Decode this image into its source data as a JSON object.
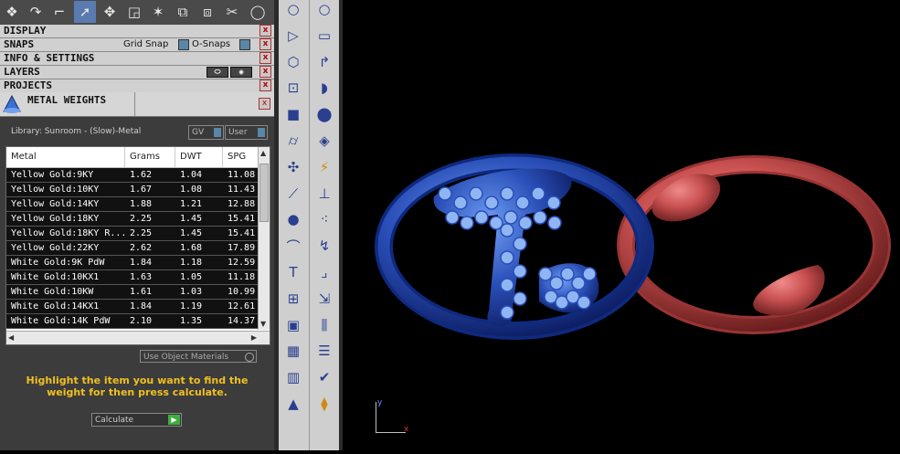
{
  "panels": {
    "display": "DISPLAY",
    "snaps": "SNAPS",
    "grid_snap": "Grid Snap",
    "o_snaps": "O-Snaps",
    "info": "INFO & SETTINGS",
    "layers": "LAYERS",
    "projects": "PROJECTS",
    "close": "x"
  },
  "metal_weights": {
    "title": "METAL WEIGHTS",
    "library": "Library: Sunroom - (Slow)-Metal",
    "gv_label": "GV",
    "user_label": "User",
    "columns": [
      "Metal",
      "Grams",
      "DWT",
      "SPG"
    ],
    "rows": [
      [
        "Yellow Gold:9KY",
        "1.62",
        "1.04",
        "11.08"
      ],
      [
        "Yellow Gold:10KY",
        "1.67",
        "1.08",
        "11.43"
      ],
      [
        "Yellow Gold:14KY",
        "1.88",
        "1.21",
        "12.88"
      ],
      [
        "Yellow Gold:18KY",
        "2.25",
        "1.45",
        "15.41"
      ],
      [
        "Yellow Gold:18KY R...",
        "2.25",
        "1.45",
        "15.41"
      ],
      [
        "Yellow Gold:22KY",
        "2.62",
        "1.68",
        "17.89"
      ],
      [
        "White Gold:9K PdW",
        "1.84",
        "1.18",
        "12.59"
      ],
      [
        "White Gold:10KX1",
        "1.63",
        "1.05",
        "11.18"
      ],
      [
        "White Gold:10KW",
        "1.61",
        "1.03",
        "10.99"
      ],
      [
        "White Gold:14KX1",
        "1.84",
        "1.19",
        "12.61"
      ],
      [
        "White Gold:14K PdW",
        "2.10",
        "1.35",
        "14.37"
      ]
    ],
    "use_object_materials": "Use Object Materials",
    "instruction": "Highlight the item you want to find the weight for then press calculate.",
    "calculate": "Calculate"
  },
  "viewport": {
    "axis_y": "y",
    "axis_x": "x",
    "colors": {
      "blue_ring": "#2a4fb8",
      "red_ring": "#c85050",
      "background": "#000000"
    }
  },
  "icons": {
    "top_toolbar": [
      "cubes-icon",
      "curve-arrow-icon",
      "corner-path-icon",
      "select-arrow-icon",
      "move-icon",
      "scale-icon",
      "spark-icon",
      "link-icon",
      "unlink-icon",
      "scissors-icon",
      "circle-icon"
    ],
    "left_column": [
      "circle-icon",
      "triangle-icon",
      "hexagon-icon",
      "square-points-icon",
      "cube-icon",
      "cylinder-icon",
      "puzzle-icon",
      "blade-icon",
      "spheres-icon",
      "curve-icon",
      "text-icon",
      "array-icon",
      "box-icon",
      "grid-icon",
      "gem-icon",
      "shapes-icon"
    ],
    "right_column": [
      "circle-icon",
      "rectangle-icon",
      "arc-icon",
      "loft-icon",
      "sphere-blend-icon",
      "surface-icon",
      "lightning-icon",
      "profile-icon",
      "dots-icon",
      "sweep-icon",
      "corner-icon",
      "export-icon",
      "pins-icon",
      "stack-icon",
      "check-icon",
      "bucket-icon"
    ]
  }
}
